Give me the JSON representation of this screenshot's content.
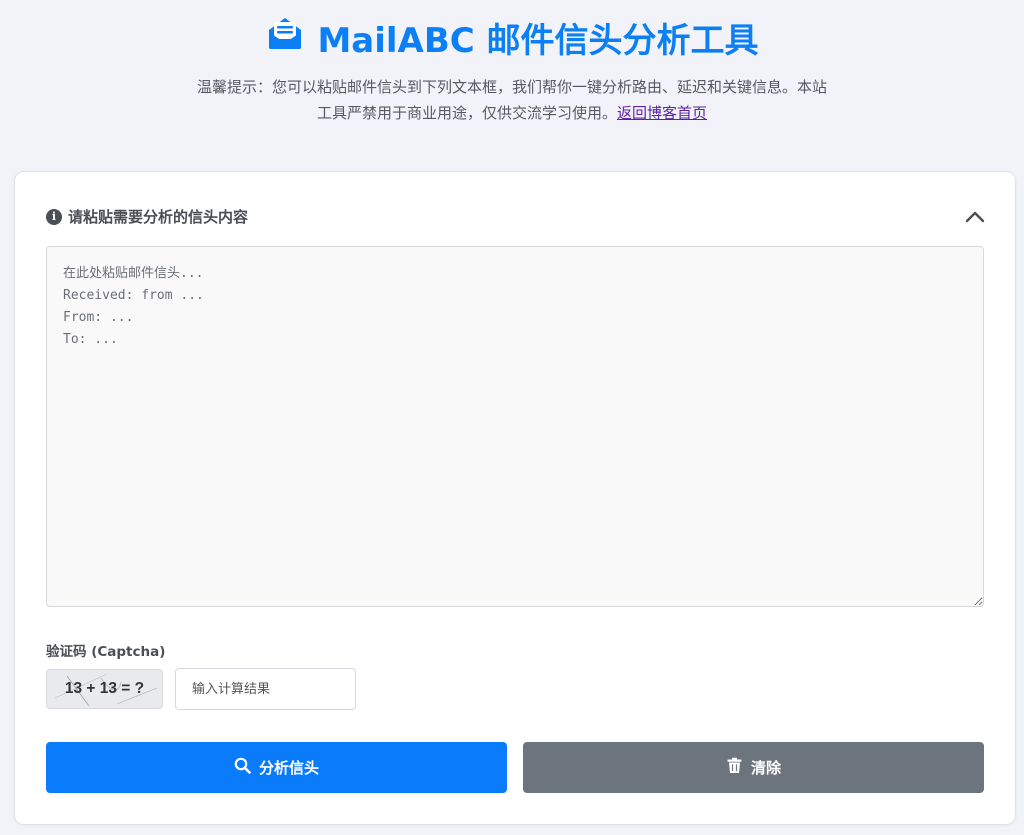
{
  "header": {
    "title": "MailABC 邮件信头分析工具",
    "notice": "温馨提示：您可以粘贴邮件信头到下列文本框，我们帮你一键分析路由、延迟和关键信息。本站工具严禁用于商业用途，仅供交流学习使用。",
    "blog_link": "返回博客首页"
  },
  "form": {
    "section_label": "请粘贴需要分析的信头内容",
    "textarea_placeholder": "在此处粘贴邮件信头...\nReceived: from ...\nFrom: ...\nTo: ...",
    "captcha_label": "验证码 (Captcha)",
    "captcha_question": "13 + 13 = ?",
    "captcha_placeholder": "输入计算结果"
  },
  "buttons": {
    "analyze": "分析信头",
    "clear": "清除"
  },
  "colors": {
    "brand": "#0d7ff5",
    "primary_button": "#0a7bfa",
    "secondary_button": "#6c757e",
    "link": "#5b1fa8"
  },
  "icons": {
    "logo": "envelope-open-text-icon",
    "info": "info-circle-icon",
    "collapse": "chevron-up-icon",
    "analyze": "search-icon",
    "clear": "trash-icon"
  }
}
